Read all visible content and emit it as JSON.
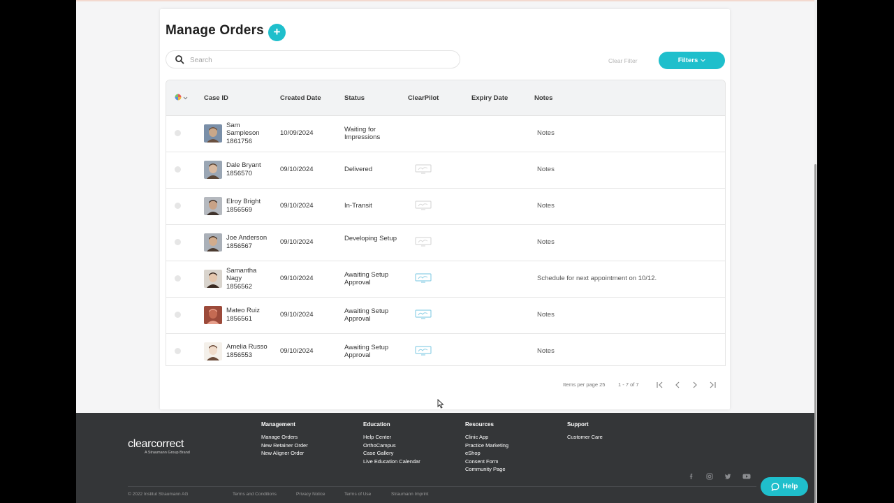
{
  "header": {
    "title": "Manage Orders",
    "add_symbol": "+"
  },
  "search": {
    "placeholder": "Search",
    "value": ""
  },
  "toolbar": {
    "clear_filter_label": "Clear Filter",
    "filters_label": "Filters"
  },
  "table": {
    "columns": [
      "Case ID",
      "Created Date",
      "Status",
      "ClearPilot",
      "Expiry Date",
      "Notes"
    ],
    "rows": [
      {
        "name": "Sam Sampleson",
        "id": "1861756",
        "created": "10/09/2024",
        "status": "Waiting for Impressions",
        "clearpilot": "none",
        "notes": "Notes"
      },
      {
        "name": "Dale Bryant",
        "id": "1856570",
        "created": "09/10/2024",
        "status": "Delivered",
        "clearpilot": "grey",
        "notes": "Notes"
      },
      {
        "name": "Elroy Bright",
        "id": "1856569",
        "created": "09/10/2024",
        "status": "In-Transit",
        "clearpilot": "grey",
        "notes": "Notes"
      },
      {
        "name": "Joe Anderson",
        "id": "1856567",
        "created": "09/10/2024",
        "status": "Developing Setup",
        "clearpilot": "grey",
        "notes": "Notes"
      },
      {
        "name": "Samantha Nagy",
        "id": "1856562",
        "created": "09/10/2024",
        "status": "Awaiting Setup Approval",
        "clearpilot": "blue",
        "notes": "Schedule for next appointment on 10/12."
      },
      {
        "name": "Mateo Ruiz",
        "id": "1856561",
        "created": "09/10/2024",
        "status": "Awaiting Setup Approval",
        "clearpilot": "blue",
        "notes": "Notes"
      },
      {
        "name": "Amelia Russo",
        "id": "1856553",
        "created": "09/10/2024",
        "status": "Awaiting Setup Approval",
        "clearpilot": "blue",
        "notes": "Notes"
      }
    ]
  },
  "pagination": {
    "items_per_page_label": "Items per page 25",
    "range_label": "1 - 7 of 7"
  },
  "footer": {
    "logo_text": "clearcorrect",
    "logo_tagline": "A Straumann Group Brand",
    "columns": [
      {
        "heading": "Management",
        "links": [
          "Manage Orders",
          "New Retainer Order",
          "New Aligner Order"
        ]
      },
      {
        "heading": "Education",
        "links": [
          "Help Center",
          "OrthoCampus",
          "Case Gallery",
          "Live Education Calendar"
        ]
      },
      {
        "heading": "Resources",
        "links": [
          "Clinic App",
          "Practice Marketing",
          "eShop",
          "Consent Form",
          "Community Page"
        ]
      },
      {
        "heading": "Support",
        "links": [
          "Customer Care"
        ]
      }
    ],
    "copyright": "© 2022 Institut Straumann AG",
    "legal_links": [
      "Terms and Conditions",
      "Privacy Notice",
      "Terms of Use",
      "Straumann Imprint"
    ]
  },
  "help": {
    "label": "Help"
  },
  "colors": {
    "accent": "#1fbfcc",
    "footer_bg": "#343638",
    "clearpilot_blue": "#8fd0e6",
    "clearpilot_grey": "#d9d9d9"
  }
}
